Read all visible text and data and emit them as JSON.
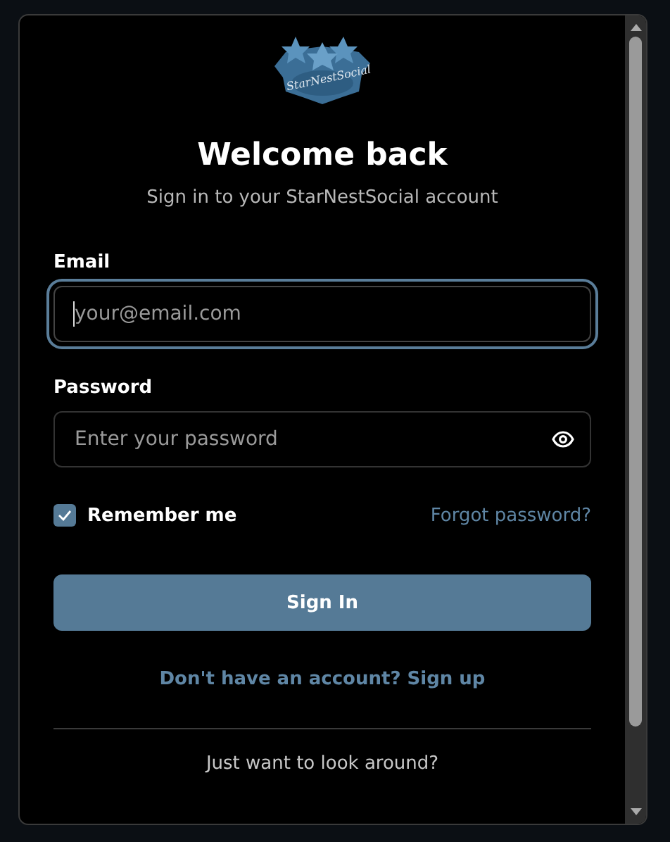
{
  "logo": {
    "text": "StarNestSocial"
  },
  "title": "Welcome back",
  "subtitle": "Sign in to your StarNestSocial account",
  "fields": [
    {
      "kind": "email",
      "label": "Email",
      "placeholder": "your@email.com",
      "focused": true
    },
    {
      "kind": "password",
      "label": "Password",
      "placeholder": "Enter your password",
      "focused": false
    }
  ],
  "remember": {
    "label": "Remember me",
    "checked": true
  },
  "forgot_link": "Forgot password?",
  "submit": "Sign In",
  "signup_link": "Don't have an account? Sign up",
  "guest_prompt": "Just want to look around?"
}
